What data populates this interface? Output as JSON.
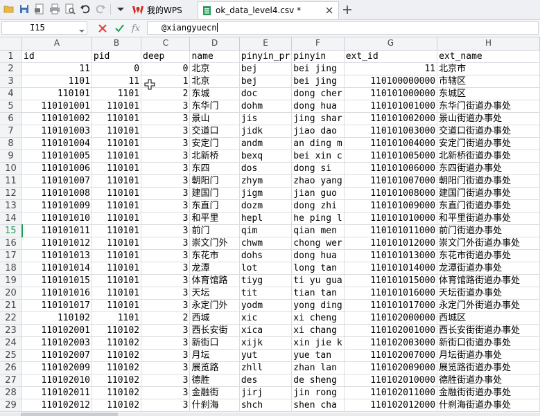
{
  "tabs": [
    {
      "label": "我的WPS"
    },
    {
      "label": "ok_data_level4.csv *"
    }
  ],
  "formula_bar": {
    "name_box": "I15",
    "fx_label": "fx",
    "content": "@xiangyuecn"
  },
  "grid": {
    "columns": [
      "A",
      "B",
      "C",
      "D",
      "E",
      "F",
      "G",
      "H"
    ],
    "active_row": 15,
    "rows": [
      {
        "n": 1,
        "c": [
          "id",
          "pid",
          "deep",
          "name",
          "pinyin_pr",
          "pinyin",
          "ext_id",
          "ext_name"
        ]
      },
      {
        "n": 2,
        "c": [
          "11",
          "0",
          "0",
          "北京",
          "bej",
          "bei jing",
          "11",
          "北京市"
        ]
      },
      {
        "n": 3,
        "c": [
          "1101",
          "11",
          "1",
          "北京",
          "bej",
          "bei jing",
          "110100000000",
          "市辖区"
        ]
      },
      {
        "n": 4,
        "c": [
          "110101",
          "1101",
          "2",
          "东城",
          "doc",
          "dong cher",
          "110101000000",
          "东城区"
        ]
      },
      {
        "n": 5,
        "c": [
          "110101001",
          "110101",
          "3",
          "东华门",
          "dohm",
          "dong hua",
          "110101001000",
          "东华门街道办事处"
        ]
      },
      {
        "n": 6,
        "c": [
          "110101002",
          "110101",
          "3",
          "景山",
          "jis",
          "jing shar",
          "110101002000",
          "景山街道办事处"
        ]
      },
      {
        "n": 7,
        "c": [
          "110101003",
          "110101",
          "3",
          "交道口",
          "jidk",
          "jiao dao",
          "110101003000",
          "交道口街道办事处"
        ]
      },
      {
        "n": 8,
        "c": [
          "110101004",
          "110101",
          "3",
          "安定门",
          "andm",
          "an ding m",
          "110101004000",
          "安定门街道办事处"
        ]
      },
      {
        "n": 9,
        "c": [
          "110101005",
          "110101",
          "3",
          "北新桥",
          "bexq",
          "bei xin c",
          "110101005000",
          "北新桥街道办事处"
        ]
      },
      {
        "n": 10,
        "c": [
          "110101006",
          "110101",
          "3",
          "东四",
          "dos",
          "dong si",
          "110101006000",
          "东四街道办事处"
        ]
      },
      {
        "n": 11,
        "c": [
          "110101007",
          "110101",
          "3",
          "朝阳门",
          "zhym",
          "zhao yang",
          "110101007000",
          "朝阳门街道办事处"
        ]
      },
      {
        "n": 12,
        "c": [
          "110101008",
          "110101",
          "3",
          "建国门",
          "jigm",
          "jian guo",
          "110101008000",
          "建国门街道办事处"
        ]
      },
      {
        "n": 13,
        "c": [
          "110101009",
          "110101",
          "3",
          "东直门",
          "dozm",
          "dong zhi",
          "110101009000",
          "东直门街道办事处"
        ]
      },
      {
        "n": 14,
        "c": [
          "110101010",
          "110101",
          "3",
          "和平里",
          "hepl",
          "he ping l",
          "110101010000",
          "和平里街道办事处"
        ]
      },
      {
        "n": 15,
        "c": [
          "110101011",
          "110101",
          "3",
          "前门",
          "qim",
          "qian men",
          "110101011000",
          "前门街道办事处"
        ]
      },
      {
        "n": 16,
        "c": [
          "110101012",
          "110101",
          "3",
          "崇文门外",
          "chwm",
          "chong wer",
          "110101012000",
          "崇文门外街道办事处"
        ]
      },
      {
        "n": 17,
        "c": [
          "110101013",
          "110101",
          "3",
          "东花市",
          "dohs",
          "dong hua",
          "110101013000",
          "东花市街道办事处"
        ]
      },
      {
        "n": 18,
        "c": [
          "110101014",
          "110101",
          "3",
          "龙潭",
          "lot",
          "long tan",
          "110101014000",
          "龙潭街道办事处"
        ]
      },
      {
        "n": 19,
        "c": [
          "110101015",
          "110101",
          "3",
          "体育馆路",
          "tiyg",
          "ti yu gua",
          "110101015000",
          "体育馆路街道办事处"
        ]
      },
      {
        "n": 20,
        "c": [
          "110101016",
          "110101",
          "3",
          "天坛",
          "tit",
          "tian tan",
          "110101016000",
          "天坛街道办事处"
        ]
      },
      {
        "n": 21,
        "c": [
          "110101017",
          "110101",
          "3",
          "永定门外",
          "yodm",
          "yong ding",
          "110101017000",
          "永定门外街道办事处"
        ]
      },
      {
        "n": 22,
        "c": [
          "110102",
          "1101",
          "2",
          "西城",
          "xic",
          "xi cheng",
          "110102000000",
          "西城区"
        ]
      },
      {
        "n": 23,
        "c": [
          "110102001",
          "110102",
          "3",
          "西长安街",
          "xica",
          "xi chang",
          "110102001000",
          "西长安街街道办事处"
        ]
      },
      {
        "n": 24,
        "c": [
          "110102003",
          "110102",
          "3",
          "新街口",
          "xijk",
          "xin jie k",
          "110102003000",
          "新街口街道办事处"
        ]
      },
      {
        "n": 25,
        "c": [
          "110102007",
          "110102",
          "3",
          "月坛",
          "yut",
          "yue tan",
          "110102007000",
          "月坛街道办事处"
        ]
      },
      {
        "n": 26,
        "c": [
          "110102009",
          "110102",
          "3",
          "展览路",
          "zhll",
          "zhan lan",
          "110102009000",
          "展览路街道办事处"
        ]
      },
      {
        "n": 27,
        "c": [
          "110102010",
          "110102",
          "3",
          "德胜",
          "des",
          "de sheng",
          "110102010000",
          "德胜街道办事处"
        ]
      },
      {
        "n": 28,
        "c": [
          "110102011",
          "110102",
          "3",
          "金融街",
          "jirj",
          "jin rong",
          "110102011000",
          "金融街街道办事处"
        ]
      },
      {
        "n": 29,
        "c": [
          "110102012",
          "110102",
          "3",
          "什刹海",
          "shch",
          "shen cha",
          "110102012000",
          "什刹海街道办事处"
        ]
      }
    ]
  },
  "colors": {
    "accent_green": "#1f9d55",
    "wps_red": "#d6281e",
    "cancel_red": "#e04040"
  }
}
